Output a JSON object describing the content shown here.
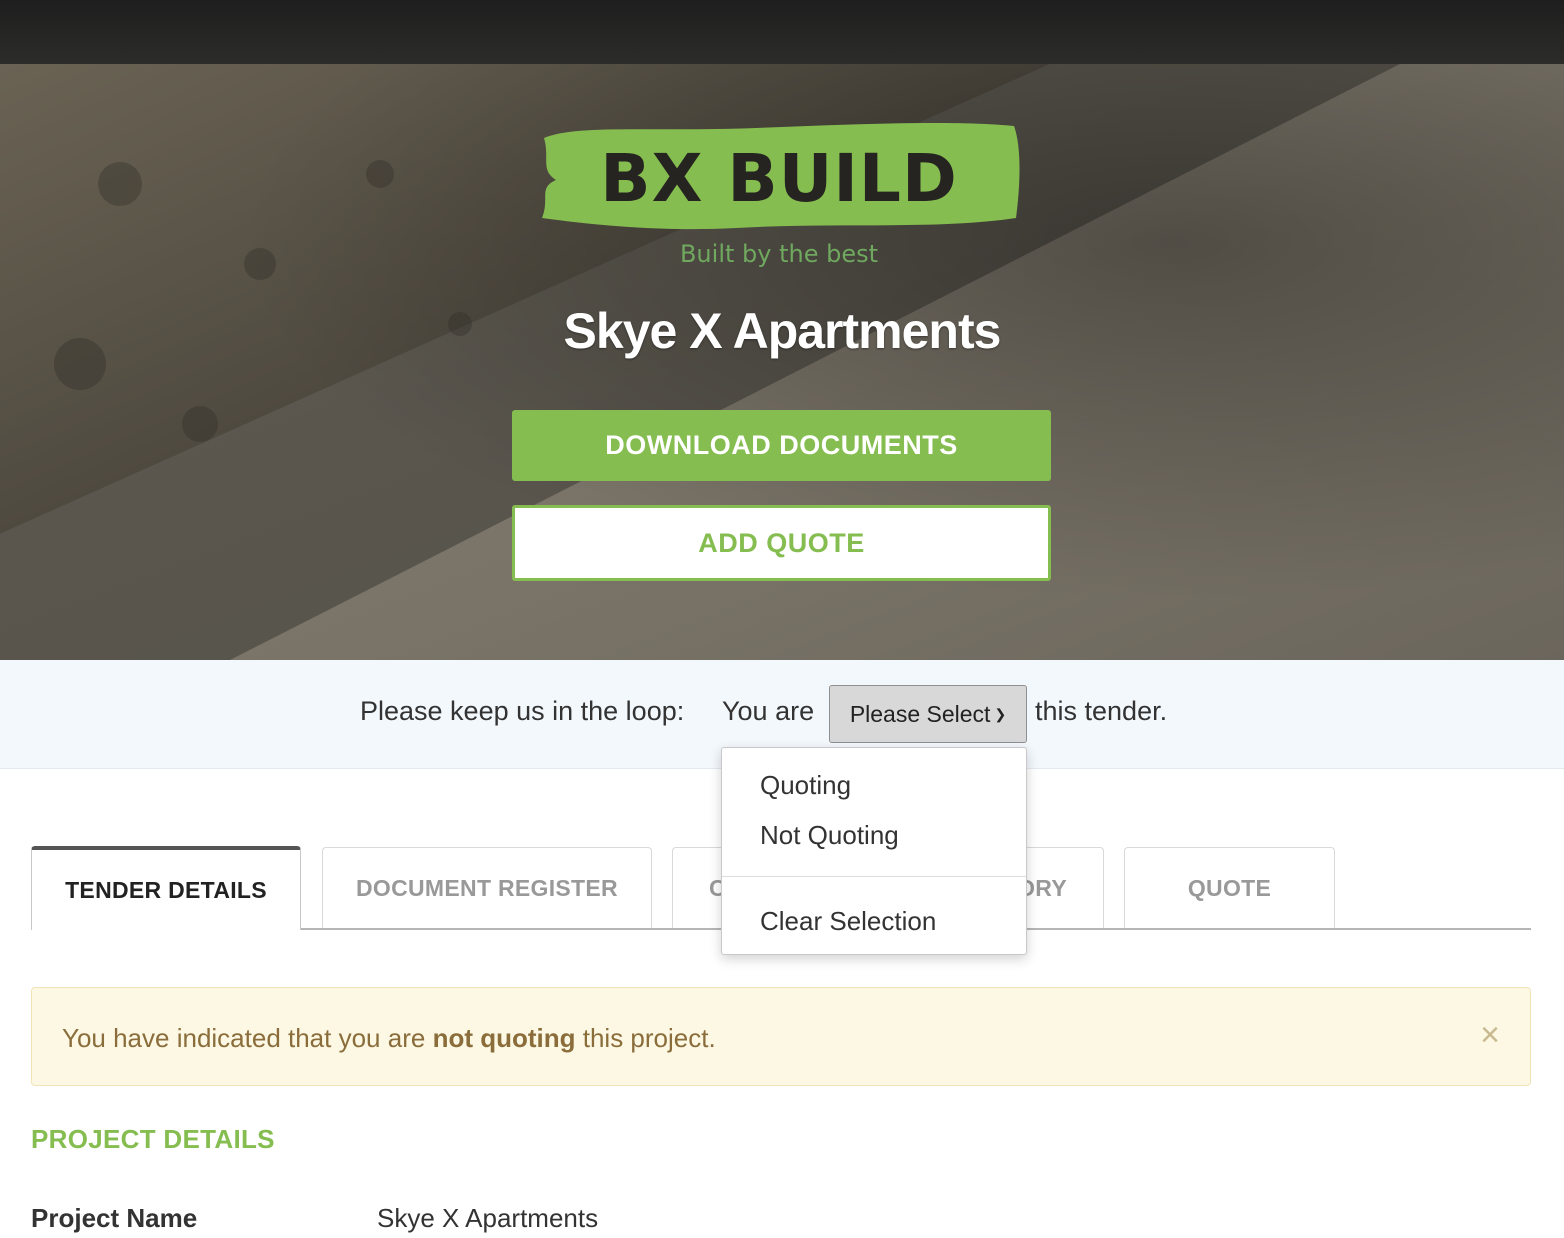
{
  "brand": {
    "name": "BX BUILD",
    "tagline": "Built by the best",
    "accent_color": "#86bd50"
  },
  "hero": {
    "title": "Skye X Apartments",
    "download_button": "DOWNLOAD DOCUMENTS",
    "add_quote_button": "ADD QUOTE"
  },
  "loop": {
    "prefix": "Please keep us in the loop:",
    "you_are": "You are",
    "select_value": "Please Select",
    "suffix": "this tender.",
    "options": [
      "Quoting",
      "Not Quoting"
    ],
    "clear": "Clear Selection"
  },
  "tabs": [
    {
      "label": "TENDER DETAILS",
      "active": true
    },
    {
      "label": "DOCUMENT REGISTER",
      "active": false
    },
    {
      "label": "C",
      "active": false
    },
    {
      "label": "ORY",
      "active": false
    },
    {
      "label": "QUOTE",
      "active": false
    }
  ],
  "alert": {
    "before": "You have indicated that you are",
    "bold": "not quoting",
    "after": "this project.",
    "close": "×"
  },
  "project_details": {
    "title": "PROJECT DETAILS",
    "rows": [
      {
        "label": "Project Name",
        "value": "Skye X Apartments"
      }
    ]
  }
}
